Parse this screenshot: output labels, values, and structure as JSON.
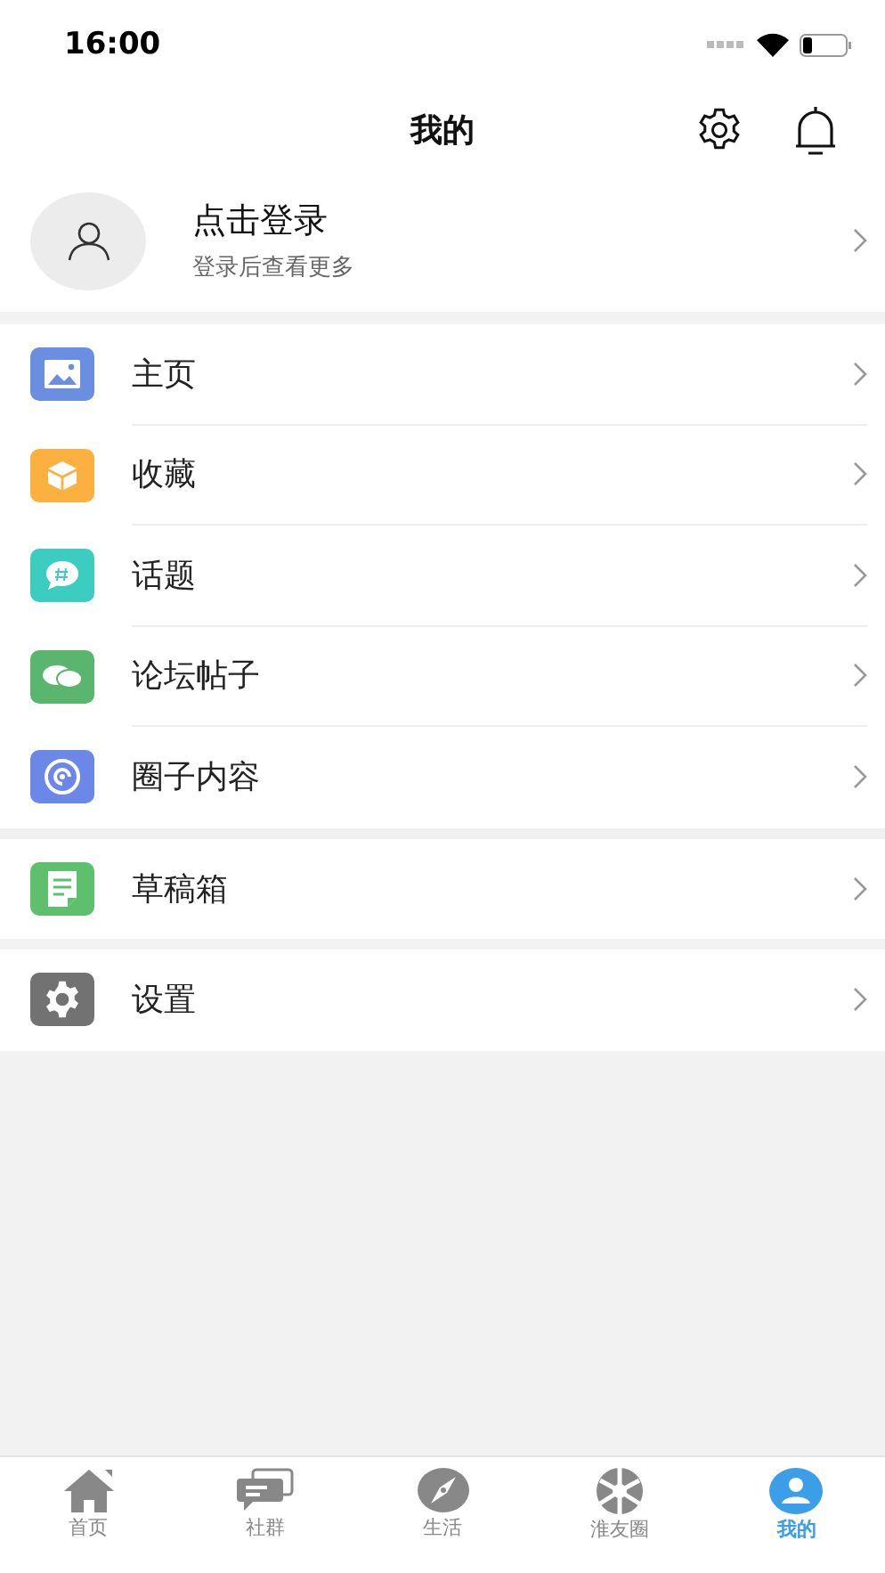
{
  "status_bar": {
    "time": "16:00"
  },
  "header": {
    "title": "我的"
  },
  "profile": {
    "name": "点击登录",
    "subtitle": "登录后查看更多"
  },
  "menu_groups": [
    {
      "items": [
        {
          "label": "主页",
          "kind": "picture",
          "color": "#6a8fe0"
        },
        {
          "label": "收藏",
          "kind": "box",
          "color": "#fbb03f"
        },
        {
          "label": "话题",
          "kind": "topic",
          "color": "#3ccdc0"
        },
        {
          "label": "论坛帖子",
          "kind": "chat",
          "color": "#5ab56e"
        },
        {
          "label": "圈子内容",
          "kind": "swirl",
          "color": "#6b88e6"
        }
      ]
    },
    {
      "items": [
        {
          "label": "草稿箱",
          "kind": "note",
          "color": "#5ebf6c"
        }
      ]
    },
    {
      "items": [
        {
          "label": "设置",
          "kind": "gear",
          "color": "#727272"
        }
      ]
    }
  ],
  "tab_bar": [
    {
      "label": "首页",
      "kind": "home",
      "selected": false
    },
    {
      "label": "社群",
      "kind": "community",
      "selected": false
    },
    {
      "label": "生活",
      "kind": "compass",
      "selected": false
    },
    {
      "label": "淮友圈",
      "kind": "aperture",
      "selected": false
    },
    {
      "label": "我的",
      "kind": "me",
      "selected": true
    }
  ]
}
